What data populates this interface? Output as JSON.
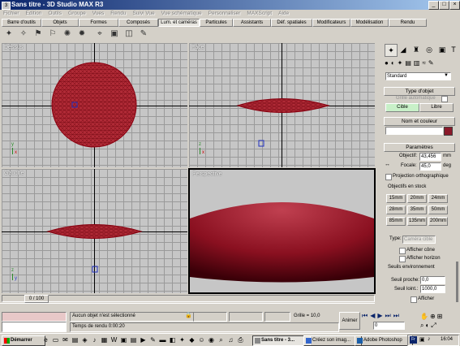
{
  "window": {
    "title": "Sans titre - 3D Studio MAX R3",
    "app_icon": "3ds-max-icon"
  },
  "window_buttons": {
    "minimize": "_",
    "maximize": "□",
    "close": "×"
  },
  "menu": [
    "Fichier",
    "Edition",
    "Outils",
    "Groupe",
    "Vues",
    "Rendu",
    "Suivi Vue",
    "Vue schématique",
    "Personnaliser",
    "MAXScript",
    "Aide"
  ],
  "tabs": [
    "Barre d'outils",
    "Objets",
    "Formes",
    "Composés",
    "Lum. et caméras",
    "Particules",
    "Assistants",
    "Déf. spatiales",
    "Modificateurs",
    "Modélisation",
    "Rendu"
  ],
  "active_tab": "Lum. et caméras",
  "viewports": {
    "top": "Dessus",
    "front": "Face",
    "left": "Gauche",
    "perspective": "Perspective"
  },
  "command_panel": {
    "dropdown": "Standard",
    "object_type_header": "Type d'objet",
    "auto_grid_label": "Grille automatique",
    "btn_target": "Cible",
    "btn_free": "Libre",
    "name_color_header": "Nom et couleur",
    "name_value": "",
    "color": "#8b1a2a",
    "params_header": "Paramètres",
    "lens_label": "Objectif:",
    "lens_value": "43,456",
    "lens_unit": "mm",
    "fov_label": "Focale:",
    "fov_value": "45,0",
    "fov_unit": "deg",
    "ortho_label": "Projection orthographique",
    "stock_label": "Objectifs en stock",
    "stock": [
      "15mm",
      "20mm",
      "24mm",
      "28mm",
      "35mm",
      "50mm",
      "85mm",
      "135mm",
      "200mm"
    ],
    "type_label": "Type:",
    "type_value": "Caméra cible",
    "show_cone": "Afficher cône",
    "show_horizon": "Afficher horizon",
    "env_label": "Seuils environnement",
    "near_label": "Seuil proche:",
    "near_value": "0,0",
    "far_label": "Seuil loint.:",
    "far_value": "1000,0",
    "show_label": "Afficher"
  },
  "status": {
    "frame": "0 / 100",
    "selection": "Aucun objet n'est sélectionné",
    "render_time": "Temps de rendu  0:00:20",
    "grid": "Grille = 10,0",
    "animate": "Animer",
    "frame_field": "0"
  },
  "taskbar": {
    "start": "Démarrer",
    "tasks": [
      "Sans titre - 3...",
      "Créez son imag...",
      "Adobe Photoshop"
    ],
    "clock": "16:04",
    "lang": "Fr"
  },
  "colors": {
    "sphere": "#a0101e",
    "accent_green": "#c8f0c8",
    "title_blue": "#0a246a"
  }
}
